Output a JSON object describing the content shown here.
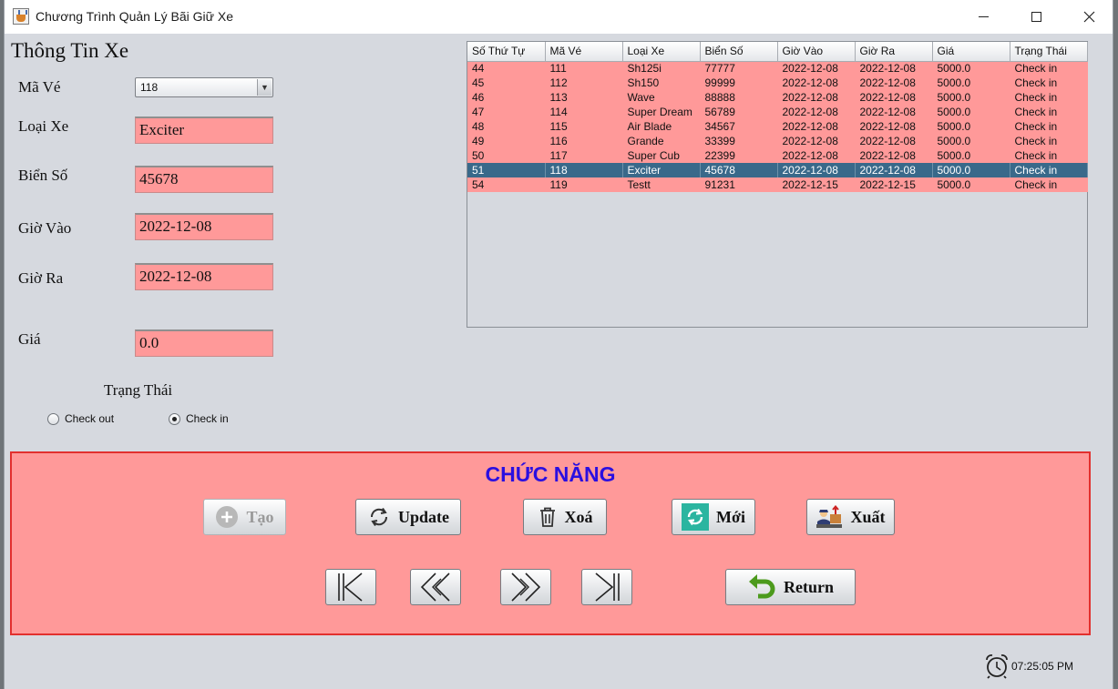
{
  "window": {
    "title": "Chương Trình Quản Lý Bãi Giữ Xe",
    "minimize": "minimize",
    "maximize": "maximize",
    "close": "close"
  },
  "form": {
    "section_title": "Thông Tin Xe",
    "ma_ve": {
      "label": "Mã Vé",
      "value": "118"
    },
    "loai_xe": {
      "label": "Loại Xe",
      "value": "Exciter"
    },
    "bien_so": {
      "label": "Biển Số",
      "value": "45678"
    },
    "gio_vao": {
      "label": "Giờ Vào",
      "value": "2022-12-08"
    },
    "gio_ra": {
      "label": "Giờ Ra",
      "value": "2022-12-08"
    },
    "gia": {
      "label": "Giá",
      "value": "0.0"
    },
    "trang_thai": {
      "label": "Trạng Thái",
      "options": [
        "Check out",
        "Check in"
      ],
      "selected": "Check in"
    }
  },
  "table": {
    "columns": [
      "Số Thứ Tự",
      "Mã Vé",
      "Loại Xe",
      "Biển Số",
      "Giờ Vào",
      "Giờ Ra",
      "Giá",
      "Trạng Thái"
    ],
    "rows": [
      [
        "44",
        "111",
        "Sh125i",
        "77777",
        "2022-12-08",
        "2022-12-08",
        "5000.0",
        "Check in"
      ],
      [
        "45",
        "112",
        "Sh150",
        "99999",
        "2022-12-08",
        "2022-12-08",
        "5000.0",
        "Check in"
      ],
      [
        "46",
        "113",
        "Wave",
        "88888",
        "2022-12-08",
        "2022-12-08",
        "5000.0",
        "Check in"
      ],
      [
        "47",
        "114",
        "Super Dream",
        "56789",
        "2022-12-08",
        "2022-12-08",
        "5000.0",
        "Check in"
      ],
      [
        "48",
        "115",
        "Air Blade",
        "34567",
        "2022-12-08",
        "2022-12-08",
        "5000.0",
        "Check in"
      ],
      [
        "49",
        "116",
        "Grande",
        "33399",
        "2022-12-08",
        "2022-12-08",
        "5000.0",
        "Check in"
      ],
      [
        "50",
        "117",
        "Super Cub",
        "22399",
        "2022-12-08",
        "2022-12-08",
        "5000.0",
        "Check in"
      ],
      [
        "51",
        "118",
        "Exciter",
        "45678",
        "2022-12-08",
        "2022-12-08",
        "5000.0",
        "Check in"
      ],
      [
        "54",
        "119",
        "Testt",
        "91231",
        "2022-12-15",
        "2022-12-15",
        "5000.0",
        "Check in"
      ]
    ],
    "selected_row": 7
  },
  "functions": {
    "title": "CHỨC NĂNG",
    "tao": "Tạo",
    "update": "Update",
    "xoa": "Xoá",
    "moi": "Mới",
    "xuat": "Xuất",
    "return": "Return",
    "nav": [
      "first",
      "previous",
      "next",
      "last"
    ]
  },
  "status": {
    "time": "07:25:05 PM"
  },
  "icons": {
    "app": "java-app-icon",
    "tao": "plus-circle-icon",
    "update": "refresh-icon",
    "xoa": "trash-icon",
    "moi": "reload-icon",
    "xuat": "export-worker-icon",
    "return": "return-arrow-icon",
    "clock": "alarm-clock-icon"
  },
  "colors": {
    "field_bg": "#ff9999",
    "selected_row": "#39698a",
    "panel_border": "#e2302e",
    "func_title": "#2a0fe0"
  }
}
